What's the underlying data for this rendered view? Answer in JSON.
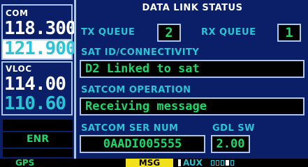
{
  "left_panel": {
    "com": {
      "tag": "COM",
      "active": "118.300",
      "standby": "121.900"
    },
    "vloc": {
      "tag": "VLOC",
      "active": "114.00",
      "standby": "110.60"
    },
    "cdi_mode": "ENR"
  },
  "page": {
    "title": "DATA LINK STATUS",
    "tx_queue": {
      "label": "TX QUEUE",
      "value": "2"
    },
    "rx_queue": {
      "label": "RX QUEUE",
      "value": "1"
    },
    "sat": {
      "label": "SAT ID/CONNECTIVITY",
      "value": "D2  Linked to sat"
    },
    "operation": {
      "label": "SATCOM OPERATION",
      "value": "Receiving message"
    },
    "serial": {
      "label": "SATCOM SER NUM",
      "value": "0AADI005555"
    },
    "gdl_sw": {
      "label": "GDL SW",
      "value": "2.00"
    }
  },
  "status_bar": {
    "mode": "GPS",
    "msg": "MSG",
    "group": "AUX",
    "page_count": 5,
    "active_page": 4
  },
  "colors": {
    "background": "#0a1f68",
    "label_cyan": "#27c5d6",
    "value_green": "#1fd66a",
    "frame": "#a9c6e8",
    "msg_yellow": "#f2e01a"
  }
}
